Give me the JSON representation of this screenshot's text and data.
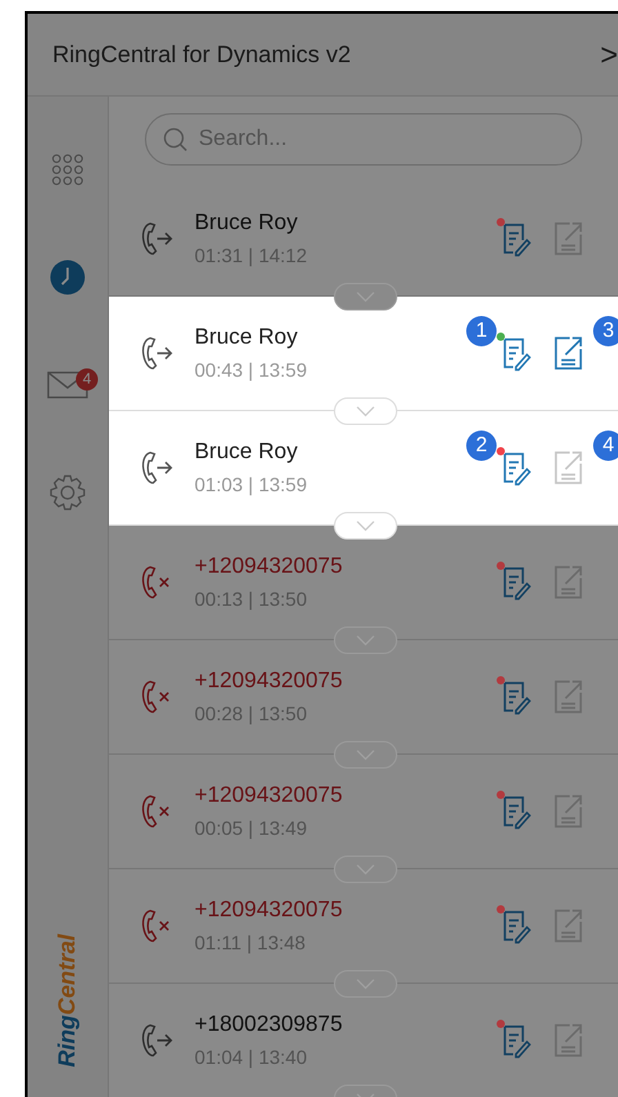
{
  "header": {
    "title": "RingCentral for Dynamics v2",
    "chevron": ">"
  },
  "sidebar": {
    "items": [
      {
        "kind": "dialpad",
        "selected": false
      },
      {
        "kind": "history",
        "selected": true
      },
      {
        "kind": "messages",
        "selected": false,
        "badge": "4"
      },
      {
        "kind": "settings",
        "selected": false
      }
    ],
    "logo": [
      "Ring",
      "Central"
    ]
  },
  "search": {
    "placeholder": "Search..."
  },
  "calls": [
    {
      "kind": "outbound",
      "name": "Bruce Roy",
      "missed": false,
      "info": "01:31 | 14:12",
      "highlighted": false,
      "log": {
        "color": "#b23a3f"
      },
      "export": {
        "enabled": false
      }
    },
    {
      "kind": "outbound",
      "name": "Bruce Roy",
      "missed": false,
      "info": "00:43 | 13:59",
      "highlighted": true,
      "log": {
        "color": "#4caf50",
        "callout": "1"
      },
      "export": {
        "enabled": true,
        "callout": "3"
      }
    },
    {
      "kind": "outbound",
      "name": "Bruce Roy",
      "missed": false,
      "info": "01:03 | 13:59",
      "highlighted": true,
      "log": {
        "color": "#f0434b",
        "callout": "2"
      },
      "export": {
        "enabled": false,
        "callout": "4"
      }
    },
    {
      "kind": "missed",
      "name": "+12094320075",
      "missed": true,
      "info": "00:13 | 13:50",
      "highlighted": false,
      "log": {
        "color": "#b23a3f"
      },
      "export": {
        "enabled": false
      }
    },
    {
      "kind": "missed",
      "name": "+12094320075",
      "missed": true,
      "info": "00:28 | 13:50",
      "highlighted": false,
      "log": {
        "color": "#b23a3f"
      },
      "export": {
        "enabled": false
      }
    },
    {
      "kind": "missed",
      "name": "+12094320075",
      "missed": true,
      "info": "00:05 | 13:49",
      "highlighted": false,
      "log": {
        "color": "#b23a3f"
      },
      "export": {
        "enabled": false
      }
    },
    {
      "kind": "missed",
      "name": "+12094320075",
      "missed": true,
      "info": "01:11 | 13:48",
      "highlighted": false,
      "log": {
        "color": "#b23a3f"
      },
      "export": {
        "enabled": false
      }
    },
    {
      "kind": "outbound",
      "name": "+18002309875",
      "missed": false,
      "info": "01:04 | 13:40",
      "highlighted": false,
      "log": {
        "color": "#b23a3f"
      },
      "export": {
        "enabled": false
      }
    }
  ]
}
